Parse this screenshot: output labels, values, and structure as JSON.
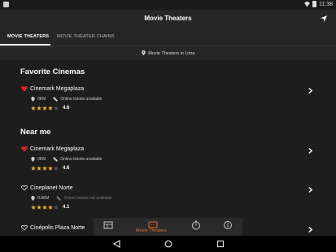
{
  "status_bar": {
    "time": "11:38",
    "icons": [
      "notification-icon",
      "wifi-icon",
      "battery-icon"
    ]
  },
  "header": {
    "title": "Movie Theaters",
    "nav_icon": "navigation-arrow-icon"
  },
  "tabs": [
    {
      "label": "MOVIE THEATERS",
      "active": true
    },
    {
      "label": "MOVIE THEATER CHAINS",
      "active": false
    }
  ],
  "location": {
    "text": "Movie Theaters in Lima"
  },
  "favorites": {
    "title": "Favorite Cinemas",
    "items": [
      {
        "name": "Cinemark Megaplaza",
        "favorite": true,
        "distance": "0KM",
        "tickets": "Online tickets available",
        "rating": "4.6",
        "stars": 4
      }
    ]
  },
  "near_me": {
    "title": "Near me",
    "items": [
      {
        "name": "Cinemark Megaplaza",
        "favorite": true,
        "distance": "0KM",
        "tickets": "Online tickets available",
        "rating": "4.6",
        "stars": 4
      },
      {
        "name": "Cineplanet Norte",
        "favorite": false,
        "distance": "0.4KM",
        "tickets": "Online tickets not available",
        "rating": "4.1",
        "stars": 4
      },
      {
        "name": "Cinépolis Plaza Norte",
        "favorite": false
      }
    ]
  },
  "bottom_nav": {
    "active_label": "Movie Theaters",
    "items": [
      "movies-icon",
      "ticket-icon",
      "timer-icon",
      "info-icon"
    ]
  },
  "colors": {
    "accent": "#e8742a",
    "heart": "#d2232a",
    "star": "#f0b429",
    "background": "#1d1d1d",
    "bar": "#262626"
  }
}
